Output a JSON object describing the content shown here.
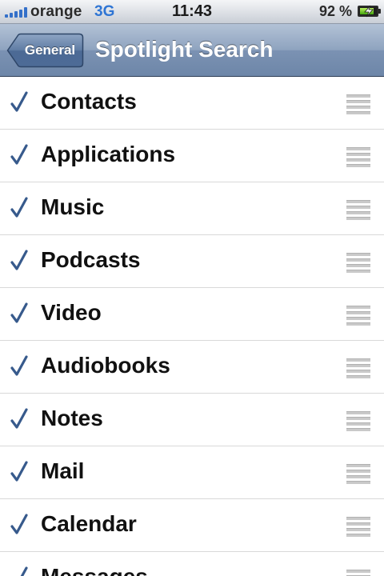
{
  "status_bar": {
    "carrier": "orange",
    "network": "3G",
    "time": "11:43",
    "battery_percent": "92 %",
    "battery_level": 0.92,
    "signal_bars": 5,
    "signal_color": "#3470c9",
    "network_color": "#2f75d4",
    "battery_charging": true,
    "battery_color": "#55b81a"
  },
  "nav_bar": {
    "back_label": "General",
    "title": "Spotlight Search",
    "color": "#6f88ab"
  },
  "check_color": "#375a8c",
  "items": [
    {
      "label": "Contacts",
      "checked": true
    },
    {
      "label": "Applications",
      "checked": true
    },
    {
      "label": "Music",
      "checked": true
    },
    {
      "label": "Podcasts",
      "checked": true
    },
    {
      "label": "Video",
      "checked": true
    },
    {
      "label": "Audiobooks",
      "checked": true
    },
    {
      "label": "Notes",
      "checked": true
    },
    {
      "label": "Mail",
      "checked": true
    },
    {
      "label": "Calendar",
      "checked": true
    },
    {
      "label": "Messages",
      "checked": true
    }
  ]
}
